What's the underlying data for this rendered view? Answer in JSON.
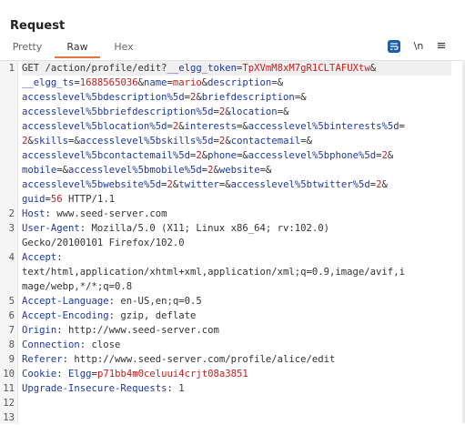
{
  "title": "Request",
  "tabs": [
    {
      "label": "Pretty"
    },
    {
      "label": "Raw"
    },
    {
      "label": "Hex"
    }
  ],
  "tools": {
    "newline_label": "\\n",
    "menu_label": "≡"
  },
  "lines": [
    {
      "n": "1",
      "parts": [
        {
          "t": "GET /action/profile/edit?",
          "c": ""
        },
        {
          "t": "__elgg_token",
          "c": "p"
        },
        {
          "t": "=",
          "c": ""
        },
        {
          "t": "TpXVmM8xM7gR1CLTAFUXtw",
          "c": "v"
        },
        {
          "t": "&",
          "c": ""
        }
      ]
    },
    {
      "n": "",
      "parts": [
        {
          "t": "__elgg_ts",
          "c": "p"
        },
        {
          "t": "=",
          "c": ""
        },
        {
          "t": "1688565036",
          "c": "v"
        },
        {
          "t": "&",
          "c": ""
        },
        {
          "t": "name",
          "c": "p"
        },
        {
          "t": "=",
          "c": ""
        },
        {
          "t": "mario",
          "c": "v"
        },
        {
          "t": "&",
          "c": ""
        },
        {
          "t": "description",
          "c": "p"
        },
        {
          "t": "=&",
          "c": ""
        }
      ]
    },
    {
      "n": "",
      "parts": [
        {
          "t": "accesslevel%5bdescription%5d",
          "c": "p"
        },
        {
          "t": "=",
          "c": ""
        },
        {
          "t": "2",
          "c": "v"
        },
        {
          "t": "&",
          "c": ""
        },
        {
          "t": "briefdescription",
          "c": "p"
        },
        {
          "t": "=&",
          "c": ""
        }
      ]
    },
    {
      "n": "",
      "parts": [
        {
          "t": "accesslevel%5bbriefdescription%5d",
          "c": "p"
        },
        {
          "t": "=",
          "c": ""
        },
        {
          "t": "2",
          "c": "v"
        },
        {
          "t": "&",
          "c": ""
        },
        {
          "t": "location",
          "c": "p"
        },
        {
          "t": "=&",
          "c": ""
        }
      ]
    },
    {
      "n": "",
      "parts": [
        {
          "t": "accesslevel%5blocation%5d",
          "c": "p"
        },
        {
          "t": "=",
          "c": ""
        },
        {
          "t": "2",
          "c": "v"
        },
        {
          "t": "&",
          "c": ""
        },
        {
          "t": "interests",
          "c": "p"
        },
        {
          "t": "=&",
          "c": ""
        },
        {
          "t": "accesslevel%5binterests%5d",
          "c": "p"
        },
        {
          "t": "=",
          "c": ""
        }
      ]
    },
    {
      "n": "",
      "parts": [
        {
          "t": "2",
          "c": "v"
        },
        {
          "t": "&",
          "c": ""
        },
        {
          "t": "skills",
          "c": "p"
        },
        {
          "t": "=&",
          "c": ""
        },
        {
          "t": "accesslevel%5bskills%5d",
          "c": "p"
        },
        {
          "t": "=",
          "c": ""
        },
        {
          "t": "2",
          "c": "v"
        },
        {
          "t": "&",
          "c": ""
        },
        {
          "t": "contactemail",
          "c": "p"
        },
        {
          "t": "=&",
          "c": ""
        }
      ]
    },
    {
      "n": "",
      "parts": [
        {
          "t": "accesslevel%5bcontactemail%5d",
          "c": "p"
        },
        {
          "t": "=",
          "c": ""
        },
        {
          "t": "2",
          "c": "v"
        },
        {
          "t": "&",
          "c": ""
        },
        {
          "t": "phone",
          "c": "p"
        },
        {
          "t": "=&",
          "c": ""
        },
        {
          "t": "accesslevel%5bphone%5d",
          "c": "p"
        },
        {
          "t": "=",
          "c": ""
        },
        {
          "t": "2",
          "c": "v"
        },
        {
          "t": "&",
          "c": ""
        }
      ]
    },
    {
      "n": "",
      "parts": [
        {
          "t": "mobile",
          "c": "p"
        },
        {
          "t": "=&",
          "c": ""
        },
        {
          "t": "accesslevel%5bmobile%5d",
          "c": "p"
        },
        {
          "t": "=",
          "c": ""
        },
        {
          "t": "2",
          "c": "v"
        },
        {
          "t": "&",
          "c": ""
        },
        {
          "t": "website",
          "c": "p"
        },
        {
          "t": "=&",
          "c": ""
        }
      ]
    },
    {
      "n": "",
      "parts": [
        {
          "t": "accesslevel%5bwebsite%5d",
          "c": "p"
        },
        {
          "t": "=",
          "c": ""
        },
        {
          "t": "2",
          "c": "v"
        },
        {
          "t": "&",
          "c": ""
        },
        {
          "t": "twitter",
          "c": "p"
        },
        {
          "t": "=&",
          "c": ""
        },
        {
          "t": "accesslevel%5btwitter%5d",
          "c": "p"
        },
        {
          "t": "=",
          "c": ""
        },
        {
          "t": "2",
          "c": "v"
        },
        {
          "t": "&",
          "c": ""
        }
      ]
    },
    {
      "n": "",
      "parts": [
        {
          "t": "guid",
          "c": "p"
        },
        {
          "t": "=",
          "c": ""
        },
        {
          "t": "56",
          "c": "v"
        },
        {
          "t": " HTTP/1.1",
          "c": ""
        }
      ]
    },
    {
      "n": "2",
      "parts": [
        {
          "t": "Host",
          "c": "h"
        },
        {
          "t": ": www.seed-server.com",
          "c": ""
        }
      ]
    },
    {
      "n": "3",
      "parts": [
        {
          "t": "User-Agent",
          "c": "h"
        },
        {
          "t": ": Mozilla/5.0 (X11; Linux x86_64; rv:102.0)",
          "c": ""
        }
      ]
    },
    {
      "n": "",
      "parts": [
        {
          "t": "Gecko/20100101 Firefox/102.0",
          "c": ""
        }
      ]
    },
    {
      "n": "4",
      "parts": [
        {
          "t": "Accept",
          "c": "h"
        },
        {
          "t": ":",
          "c": ""
        }
      ]
    },
    {
      "n": "",
      "parts": [
        {
          "t": "text/html,application/xhtml+xml,application/xml;q=0.9,image/avif,i",
          "c": ""
        }
      ]
    },
    {
      "n": "",
      "parts": [
        {
          "t": "mage/webp,*/*;q=0.8",
          "c": ""
        }
      ]
    },
    {
      "n": "5",
      "parts": [
        {
          "t": "Accept-Language",
          "c": "h"
        },
        {
          "t": ": en-US,en;q=0.5",
          "c": ""
        }
      ]
    },
    {
      "n": "6",
      "parts": [
        {
          "t": "Accept-Encoding",
          "c": "h"
        },
        {
          "t": ": gzip, deflate",
          "c": ""
        }
      ]
    },
    {
      "n": "7",
      "parts": [
        {
          "t": "Origin",
          "c": "h"
        },
        {
          "t": ": http://www.seed-server.com",
          "c": ""
        }
      ]
    },
    {
      "n": "8",
      "parts": [
        {
          "t": "Connection",
          "c": "h"
        },
        {
          "t": ": close",
          "c": ""
        }
      ]
    },
    {
      "n": "9",
      "parts": [
        {
          "t": "Referer",
          "c": "h"
        },
        {
          "t": ": http://www.seed-server.com/profile/alice/edit",
          "c": ""
        }
      ]
    },
    {
      "n": "10",
      "parts": [
        {
          "t": "Cookie",
          "c": "h"
        },
        {
          "t": ": ",
          "c": ""
        },
        {
          "t": "Elgg",
          "c": "p"
        },
        {
          "t": "=",
          "c": ""
        },
        {
          "t": "p71bb4m0celuui4crjt08a3851",
          "c": "v"
        }
      ]
    },
    {
      "n": "11",
      "parts": [
        {
          "t": "Upgrade-Insecure-Requests",
          "c": "h"
        },
        {
          "t": ": 1",
          "c": ""
        }
      ]
    },
    {
      "n": "12",
      "parts": []
    },
    {
      "n": "13",
      "parts": []
    }
  ]
}
